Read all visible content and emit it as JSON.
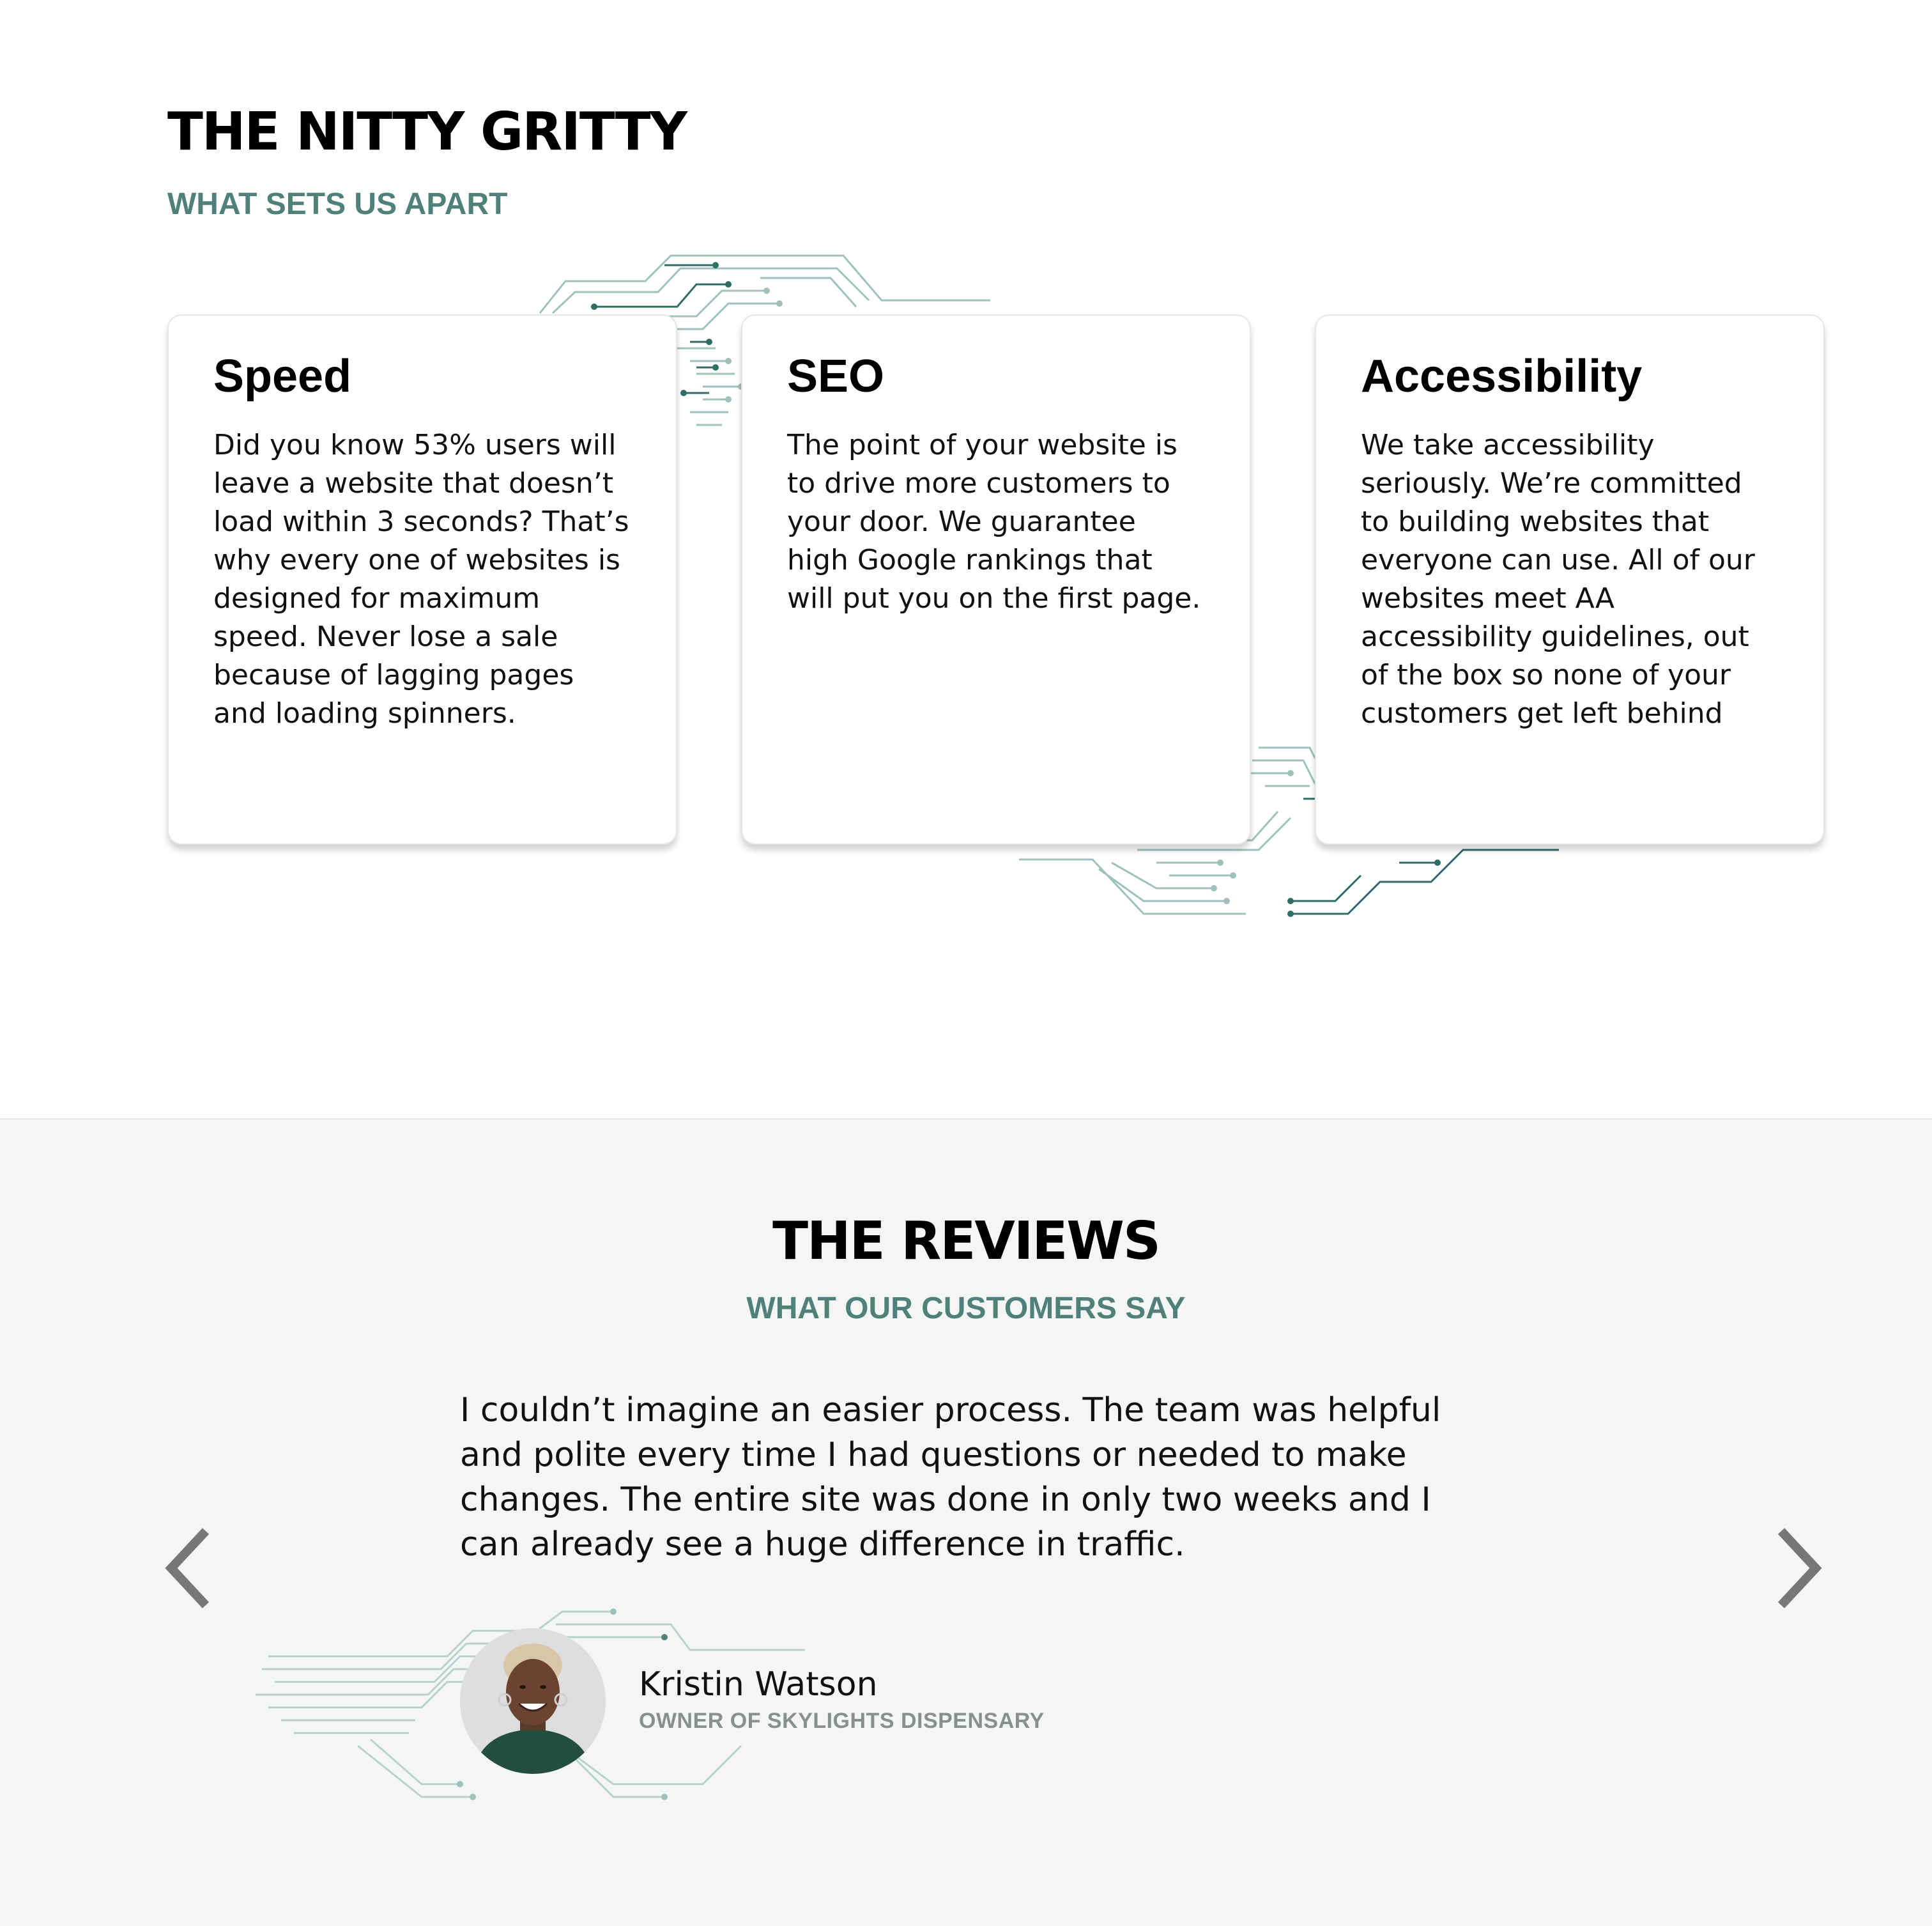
{
  "features": {
    "title": "THE NITTY GRITTY",
    "subtitle": "WHAT SETS US APART",
    "cards": [
      {
        "title": "Speed",
        "text": "Did you know 53% users will leave a website that doesn’t load within 3 seconds? That’s why every one of websites is designed for maximum speed. Never lose a sale because of lagging pages and loading spinners."
      },
      {
        "title": "SEO",
        "text": "The point of your website is to drive more customers to your door. We guarantee high Google rankings that will put you on the first page."
      },
      {
        "title": "Accessibility",
        "text": "We take accessibility seriously. We’re committed to building websites that everyone can use. All of our websites meet AA accessibility guidelines, out of the box so none of your customers get left behind"
      }
    ]
  },
  "reviews": {
    "title": "THE REVIEWS",
    "subtitle": "WHAT OUR CUSTOMERS SAY",
    "quote": "I couldn’t imagine an easier process. The team was helpful and polite every time I had questions or needed to make changes. The entire site was done in only two weeks and I can already see a huge difference in traffic.",
    "reviewer": {
      "name": "Kristin Watson",
      "role": "OWNER OF SKYLIGHTS DISPENSARY"
    },
    "nav": {
      "prev_icon": "chevron-left-icon",
      "next_icon": "chevron-right-icon"
    }
  },
  "colors": {
    "accent": "#4f807a",
    "circuit_light": "#9fc1bd",
    "circuit_dark": "#2f6d66",
    "reviews_bg": "#f4f6f5",
    "arrow": "#777777"
  }
}
